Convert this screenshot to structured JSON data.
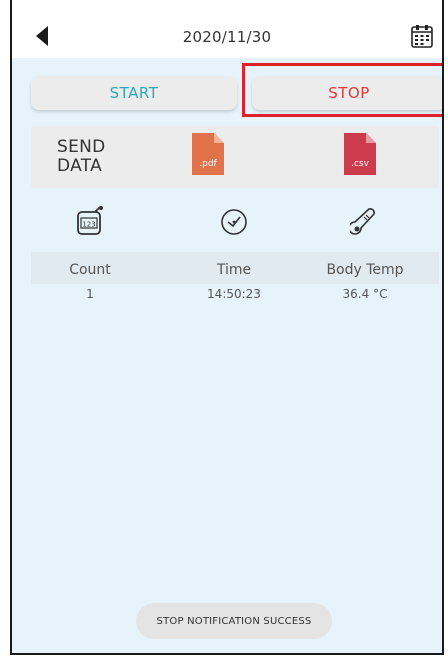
{
  "header": {
    "date": "2020/11/30",
    "back_icon": "back-arrow-icon",
    "calendar_icon": "calendar-icon"
  },
  "controls": {
    "start_label": "START",
    "stop_label": "STOP",
    "start_color": "#2ca8b8",
    "stop_color": "#e03a3a",
    "highlight_color": "#e0202a"
  },
  "send_data": {
    "label": "SEND\nDATA",
    "pdf_label": ".pdf",
    "csv_label": ".csv",
    "pdf_color": "#e2724a",
    "csv_color": "#cc3c4c"
  },
  "table": {
    "icons": [
      "counter-icon",
      "clock-icon",
      "thermometer-icon"
    ],
    "headers": [
      "Count",
      "Time",
      "Body Temp"
    ],
    "rows": [
      [
        "1",
        "14:50:23",
        "36.4 °C"
      ]
    ]
  },
  "toast": {
    "message": "STOP NOTIFICATION SUCCESS"
  }
}
